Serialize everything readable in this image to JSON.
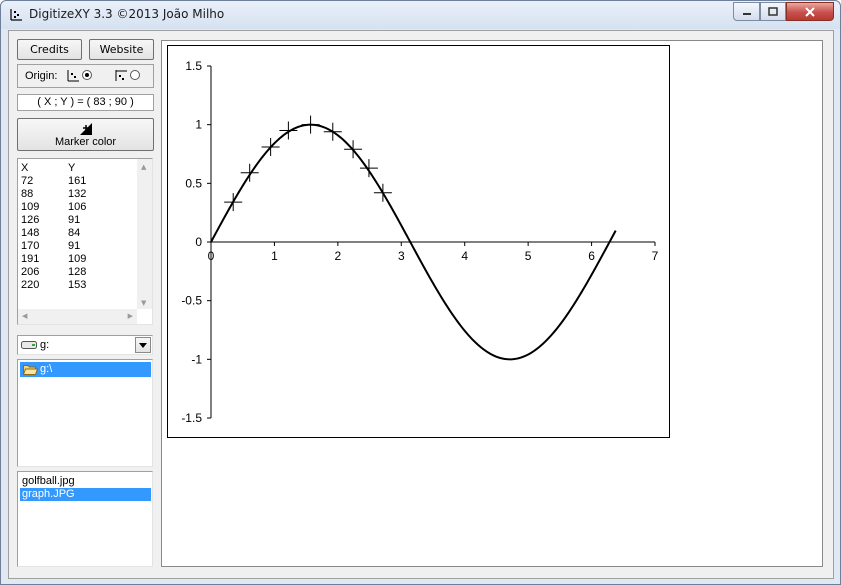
{
  "window": {
    "title": "DigitizeXY 3.3 ©2013 João Milho",
    "app_icon": "digitize-icon",
    "controls": [
      "minimize-icon",
      "maximize-icon",
      "close-icon"
    ]
  },
  "toolbar": {
    "credits_label": "Credits",
    "website_label": "Website"
  },
  "origin": {
    "label": "Origin:",
    "options": [
      {
        "icon": "origin-bottom-left-icon",
        "selected": true
      },
      {
        "icon": "origin-top-left-icon",
        "selected": false
      }
    ]
  },
  "cursor_readout": "( X ; Y ) = ( 83 ; 90 )",
  "marker_button": {
    "label": "Marker color",
    "icon": "marker-color-icon"
  },
  "points_table": {
    "headers": [
      "X",
      "Y"
    ],
    "rows": [
      [
        "72",
        "161"
      ],
      [
        "88",
        "132"
      ],
      [
        "109",
        "106"
      ],
      [
        "126",
        "91"
      ],
      [
        "148",
        "84"
      ],
      [
        "170",
        "91"
      ],
      [
        "191",
        "109"
      ],
      [
        "206",
        "128"
      ],
      [
        "220",
        "153"
      ]
    ]
  },
  "drive_select": {
    "value": "g:",
    "icon": "drive-icon"
  },
  "folder_list": [
    {
      "label": "g:\\",
      "icon": "folder-open-icon",
      "selected": true
    }
  ],
  "file_list": [
    {
      "label": "golfball.jpg",
      "selected": false
    },
    {
      "label": "graph.JPG",
      "selected": true
    }
  ],
  "chart_data": {
    "type": "line",
    "title": "",
    "xlabel": "",
    "ylabel": "",
    "xlim": [
      0,
      7
    ],
    "ylim": [
      -1.5,
      1.5
    ],
    "x_ticks": [
      "0",
      "1",
      "2",
      "3",
      "4",
      "5",
      "6",
      "7"
    ],
    "y_ticks": [
      "1.5",
      "1",
      "0.5",
      "0",
      "-0.5",
      "-1",
      "-1.5"
    ],
    "grid": false,
    "series": [
      {
        "function": "sin(x)",
        "x_start": 0,
        "x_end": 6.38,
        "color": "#000000"
      }
    ],
    "markers": {
      "shape": "plus",
      "points": [
        {
          "x": 0.35,
          "y": 0.34
        },
        {
          "x": 0.61,
          "y": 0.59
        },
        {
          "x": 0.94,
          "y": 0.81
        },
        {
          "x": 1.22,
          "y": 0.95
        },
        {
          "x": 1.57,
          "y": 1.0
        },
        {
          "x": 1.92,
          "y": 0.94
        },
        {
          "x": 2.24,
          "y": 0.79
        },
        {
          "x": 2.49,
          "y": 0.63
        },
        {
          "x": 2.71,
          "y": 0.42
        }
      ]
    }
  },
  "colors": {
    "selection": "#3399ff",
    "close_button": "#c75050",
    "window_frame": "#dfe8f3"
  }
}
